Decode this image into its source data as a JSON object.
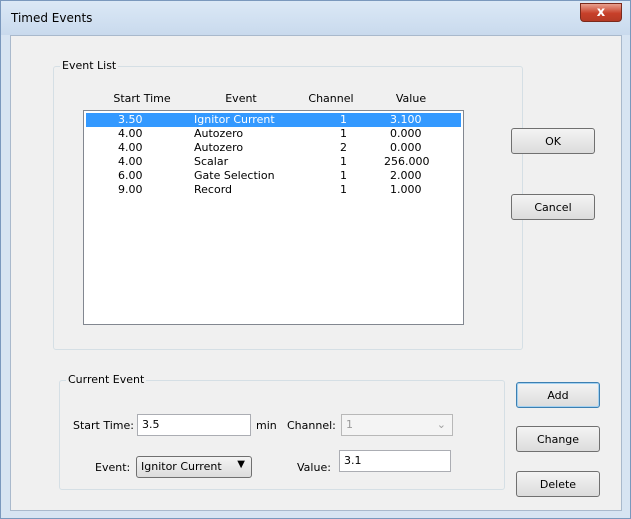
{
  "window": {
    "title": "Timed Events",
    "close_glyph": "x"
  },
  "event_list": {
    "group_label": "Event List",
    "columns": [
      "Start Time",
      "Event",
      "Channel",
      "Value"
    ],
    "rows": [
      {
        "start": "3.50",
        "event": "Ignitor Current",
        "channel": "1",
        "value": "3.100",
        "selected": true
      },
      {
        "start": "4.00",
        "event": "Autozero",
        "channel": "1",
        "value": "0.000"
      },
      {
        "start": "4.00",
        "event": "Autozero",
        "channel": "2",
        "value": "0.000"
      },
      {
        "start": "4.00",
        "event": "Scalar",
        "channel": "1",
        "value": "256.000"
      },
      {
        "start": "6.00",
        "event": "Gate Selection",
        "channel": "1",
        "value": "2.000"
      },
      {
        "start": "9.00",
        "event": "Record",
        "channel": "1",
        "value": "1.000"
      }
    ]
  },
  "buttons": {
    "ok": "OK",
    "cancel": "Cancel",
    "add": "Add",
    "change": "Change",
    "delete": "Delete"
  },
  "current_event": {
    "group_label": "Current Event",
    "start_time_label": "Start Time:",
    "start_time_value": "3.5",
    "unit": "min",
    "channel_label": "Channel:",
    "channel_value": "1",
    "event_label": "Event:",
    "event_value": "Ignitor Current",
    "value_label": "Value:",
    "value_value": "3.1"
  },
  "colors": {
    "selection": "#3399ff",
    "frame": "#d7e4f2",
    "close": "#c7402a"
  },
  "icons": {
    "close": "close-icon",
    "dropdown": "chevron-down-icon"
  }
}
